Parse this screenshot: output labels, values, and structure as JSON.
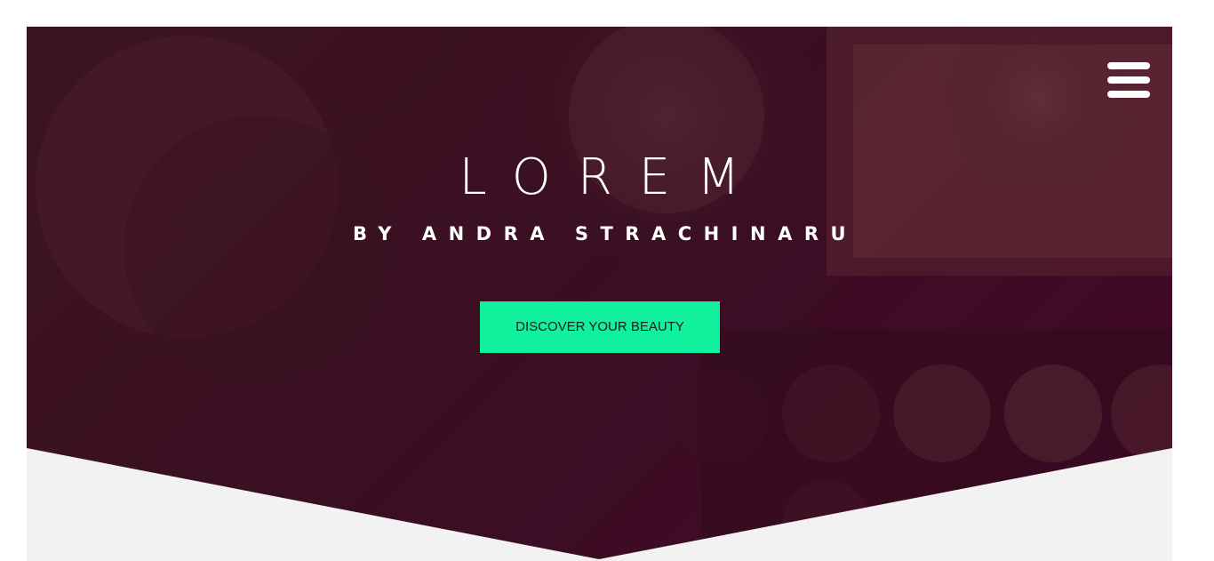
{
  "hero": {
    "title": "LOREM",
    "subtitle": "BY ANDRA STRACHINARU",
    "cta_label": "DISCOVER YOUR BEAUTY"
  },
  "colors": {
    "overlay": "#3a0f22",
    "accent": "#11f19d",
    "page_background": "#ffffff",
    "section_background": "#f2f2f2",
    "text_on_hero": "#ffffff"
  },
  "icons": {
    "menu": "hamburger-menu-icon"
  }
}
